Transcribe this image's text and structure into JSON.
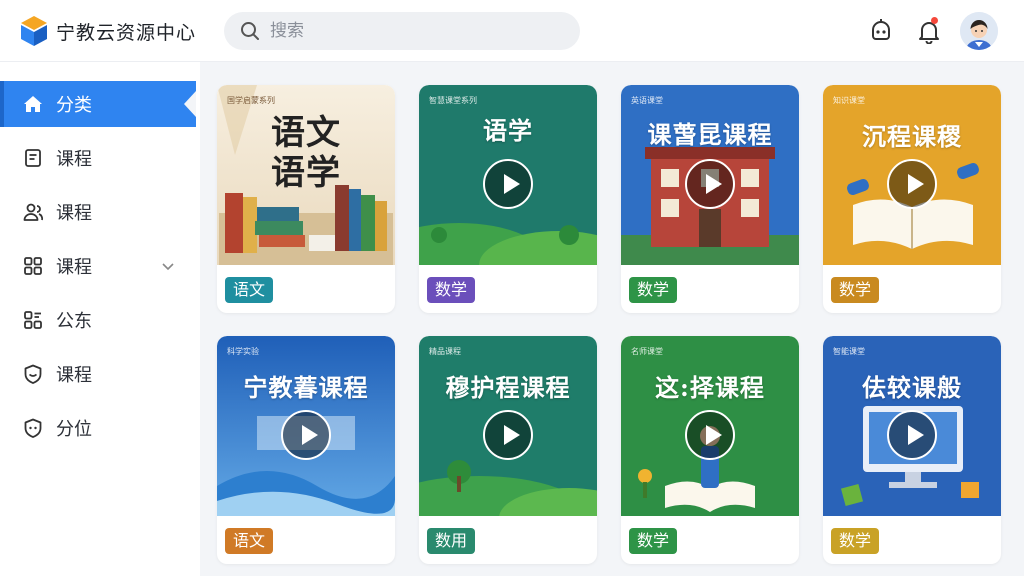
{
  "app": {
    "title": "宁教云资源中心"
  },
  "search": {
    "placeholder": "搜索"
  },
  "header": {
    "icons": [
      "bot-icon",
      "bell-icon",
      "avatar"
    ]
  },
  "sidebar": {
    "items": [
      {
        "label": "分类",
        "icon": "home-icon",
        "active": true
      },
      {
        "label": "课程",
        "icon": "document-icon"
      },
      {
        "label": "课程",
        "icon": "users-icon"
      },
      {
        "label": "课程",
        "icon": "grid-icon",
        "expandable": true
      },
      {
        "label": "公东",
        "icon": "apps-icon"
      },
      {
        "label": "课程",
        "icon": "shield-chat-icon"
      },
      {
        "label": "分位",
        "icon": "shield-chat-icon"
      }
    ]
  },
  "cards": [
    {
      "title": "语文\n语学",
      "top_text": "国学启蒙系列",
      "tag": "语文",
      "tag_color": "#1f8fa0",
      "bg": "book-library",
      "play": false
    },
    {
      "title": "语学",
      "top_text": "智慧课堂系列",
      "tag": "数学",
      "tag_color": "#6b4fbb",
      "bg": "green-field",
      "play": true
    },
    {
      "title": "课萅昆课程",
      "top_text": "英语课堂",
      "tag": "数学",
      "tag_color": "#2e9447",
      "bg": "blue-school",
      "play": true
    },
    {
      "title": "沉程课稷",
      "top_text": "知识课堂",
      "tag": "数学",
      "tag_color": "#c98a20",
      "bg": "yellow-book",
      "play": true
    },
    {
      "title": "宁教萶课程",
      "top_text": "科学实验",
      "tag": "语文",
      "tag_color": "#d07a26",
      "bg": "blue-sky",
      "play": true
    },
    {
      "title": "穆护程课程",
      "top_text": "精品课程",
      "tag": "数用",
      "tag_color": "#2a8a6e",
      "bg": "green-hills",
      "play": true
    },
    {
      "title": "这:择课程",
      "top_text": "名师课堂",
      "tag": "数学",
      "tag_color": "#2e9447",
      "bg": "green-reader",
      "play": true
    },
    {
      "title": "佉较课般",
      "top_text": "智能课堂",
      "tag": "数学",
      "tag_color": "#c9a226",
      "bg": "blue-computer",
      "play": true
    }
  ]
}
